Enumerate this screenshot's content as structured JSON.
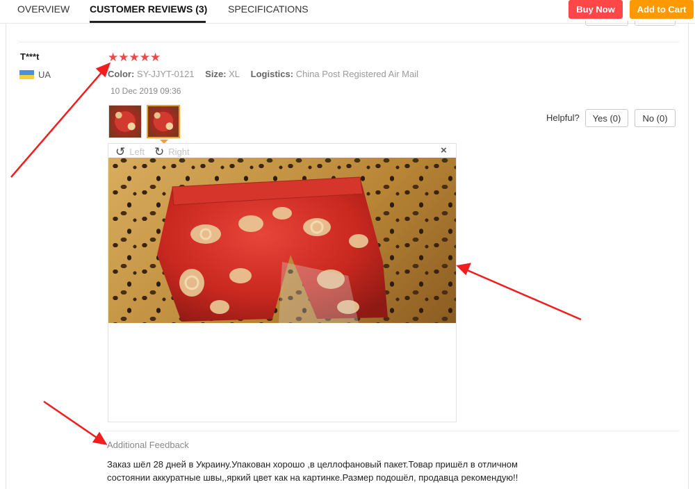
{
  "tabs": {
    "overview": "OVERVIEW",
    "reviews": "CUSTOMER REVIEWS (3)",
    "specs": "SPECIFICATIONS"
  },
  "actions": {
    "buy_now": "Buy Now",
    "add_to_cart": "Add to Cart"
  },
  "review": {
    "reviewer": "T***t",
    "country": "UA",
    "stars": "★★★★★",
    "rating": 5,
    "color_label": "Color:",
    "color_value": "SY-JJYT-0121",
    "size_label": "Size:",
    "size_value": "XL",
    "logistics_label": "Logistics:",
    "logistics_value": "China Post Registered Air Mail",
    "date": "10 Dec 2019 09:36",
    "helpful_label": "Helpful?",
    "yes_label": "Yes (0)",
    "no_label": "No (0)",
    "viewer": {
      "rotate_left": "Left",
      "rotate_right": "Right",
      "close": "×"
    },
    "feedback_title": "Additional Feedback",
    "feedback_text": "Заказ шёл 28 дней в Украину.Упакован хорошо ,в целлофановый пакет.Товар пришёл в отличном состоянии аккуратные швы,,яркий цвет как на картинке.Размер подошёл, продавца рекомендую!!"
  },
  "colors": {
    "buy_now": "#ff4747",
    "add_to_cart": "#ff9900",
    "stars": "#f04848",
    "annotation_arrow": "#f01e1e"
  }
}
